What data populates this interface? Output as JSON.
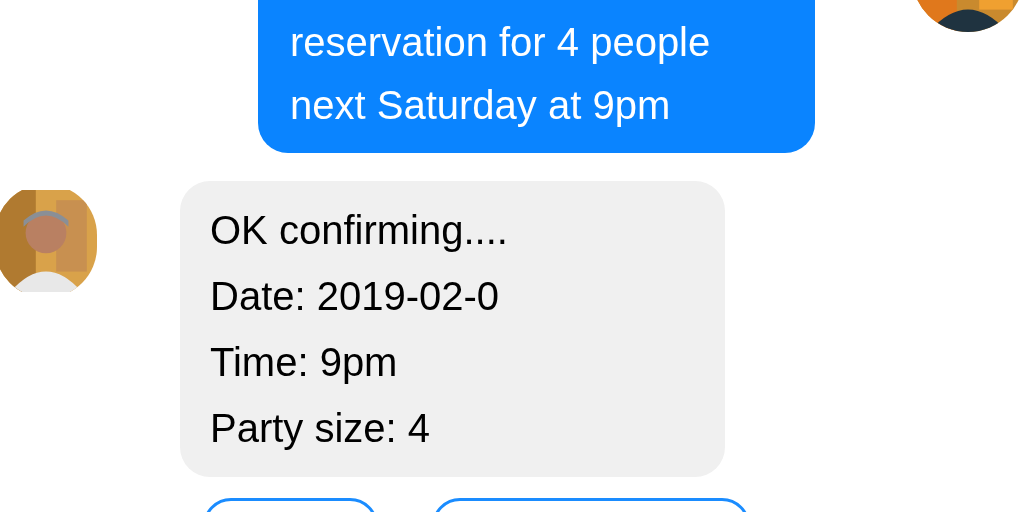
{
  "messages": [
    {
      "kind": "outgoing",
      "lines": [
        "reservation for 4 people",
        "next Saturday at 9pm"
      ]
    },
    {
      "kind": "incoming",
      "lines": [
        "OK confirming....",
        "Date: 2019-02-0",
        "Time: 9pm",
        "Party size: 4"
      ]
    }
  ]
}
